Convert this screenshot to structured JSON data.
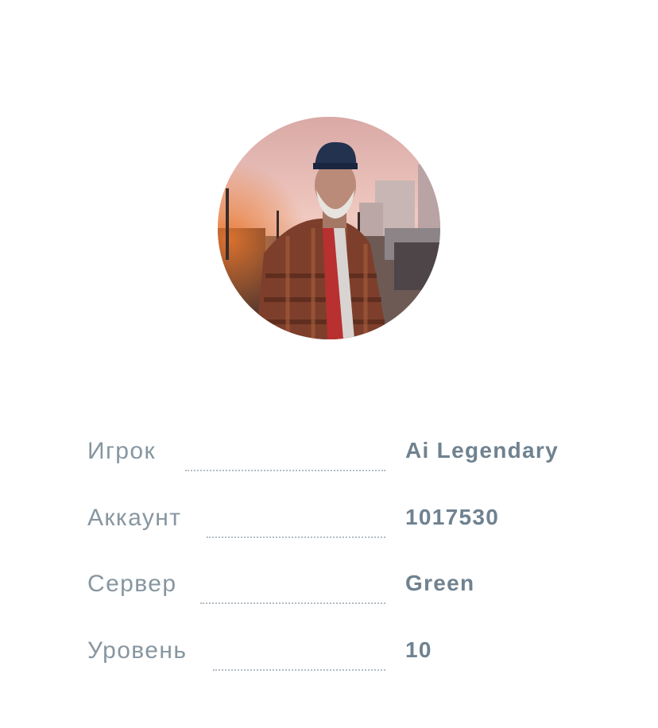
{
  "profile": {
    "avatar_alt": "",
    "rows": [
      {
        "label": "Игрок",
        "value": "Ai Legendary"
      },
      {
        "label": "Аккаунт",
        "value": "1017530"
      },
      {
        "label": "Сервер",
        "value": "Green"
      },
      {
        "label": "Уровень",
        "value": "10"
      }
    ]
  },
  "colors": {
    "label": "#8796a0",
    "value": "#6f8290",
    "dots": "#b3bcc4",
    "background": "#ffffff"
  }
}
